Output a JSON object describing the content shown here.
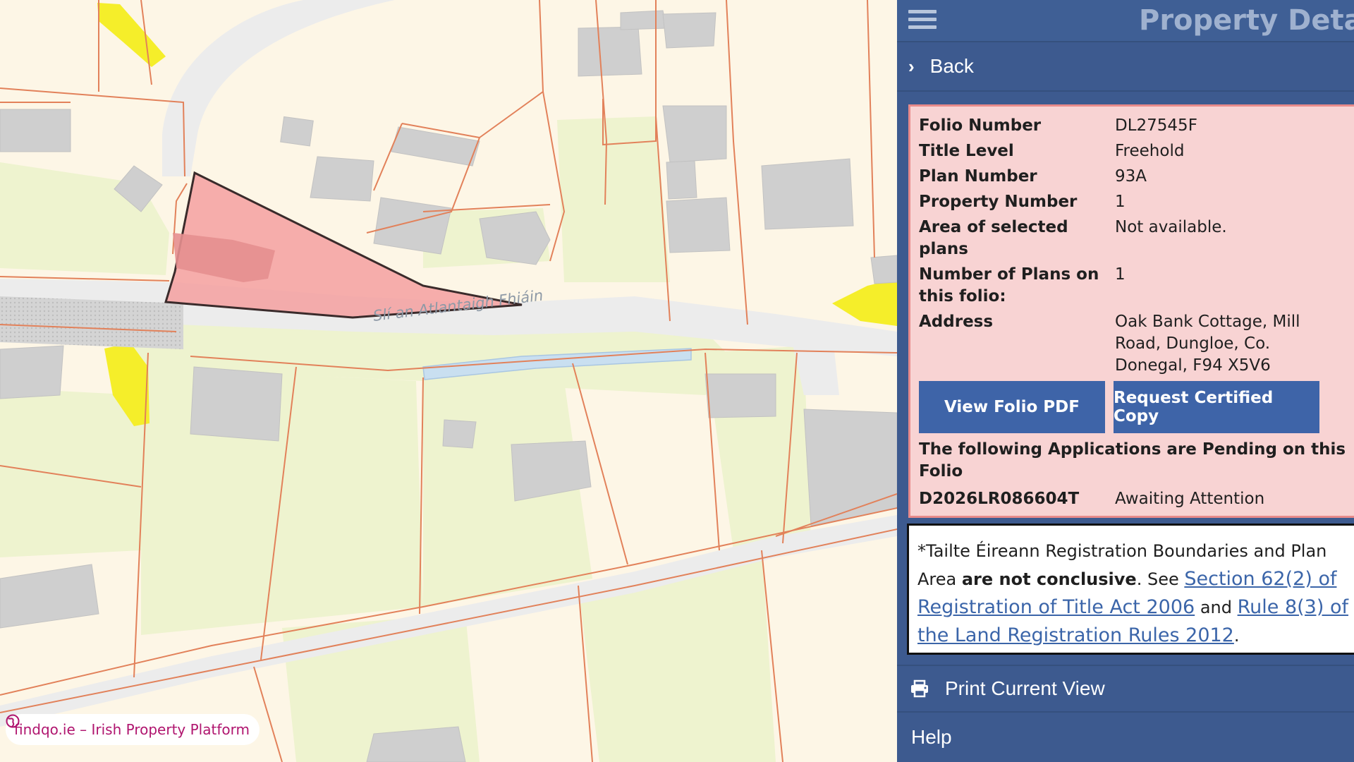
{
  "map": {
    "street_label": "Slí an Atlantaigh Fhiáin",
    "watermark": "findqo.ie – Irish Property Platform",
    "colors": {
      "background": "#fdf6e6",
      "parcel_line": "#e2815a",
      "building": "#cfcfcf",
      "road": "#ececec",
      "selected_parcel": "#f4a0a0",
      "water": "#c9dff0",
      "yellow_area": "#f5ee2a",
      "green_area": "#eef3cf"
    }
  },
  "panel": {
    "title": "Property Details",
    "back_label": "Back",
    "details": [
      {
        "label": "Folio Number",
        "value": "DL27545F"
      },
      {
        "label": "Title Level",
        "value": "Freehold"
      },
      {
        "label": "Plan Number",
        "value": "93A"
      },
      {
        "label": "Property Number",
        "value": "1"
      },
      {
        "label": "Area of selected plans",
        "value": "Not available."
      },
      {
        "label": "Number of Plans on this folio:",
        "value": "1"
      },
      {
        "label": "Address",
        "value": "Oak Bank Cottage, Mill Road, Dungloe, Co. Donegal, F94 X5V6"
      }
    ],
    "buttons": {
      "view_folio": "View Folio PDF",
      "request_copy": "Request Certified Copy"
    },
    "pending_title": "The following Applications are Pending on this Folio",
    "pending": {
      "id": "D2026LR086604T",
      "status": "Awaiting Attention"
    },
    "notice": {
      "prefix": "*Tailte Éireann Registration Boundaries and Plan Area ",
      "bold": "are not conclusive",
      "middle": ". See ",
      "link1": "Section 62(2) of Registration of Title Act 2006",
      "and": " and ",
      "link2": "Rule 8(3) of the Land Registration Rules 2012",
      "suffix": "."
    },
    "print_label": "Print Current View",
    "help_label": "Help",
    "colors": {
      "header": "#3f5f95",
      "details_bg": "#f8d3d3",
      "details_border": "#e88a8a",
      "button": "#3e64a8",
      "link": "#3b65a9"
    }
  }
}
